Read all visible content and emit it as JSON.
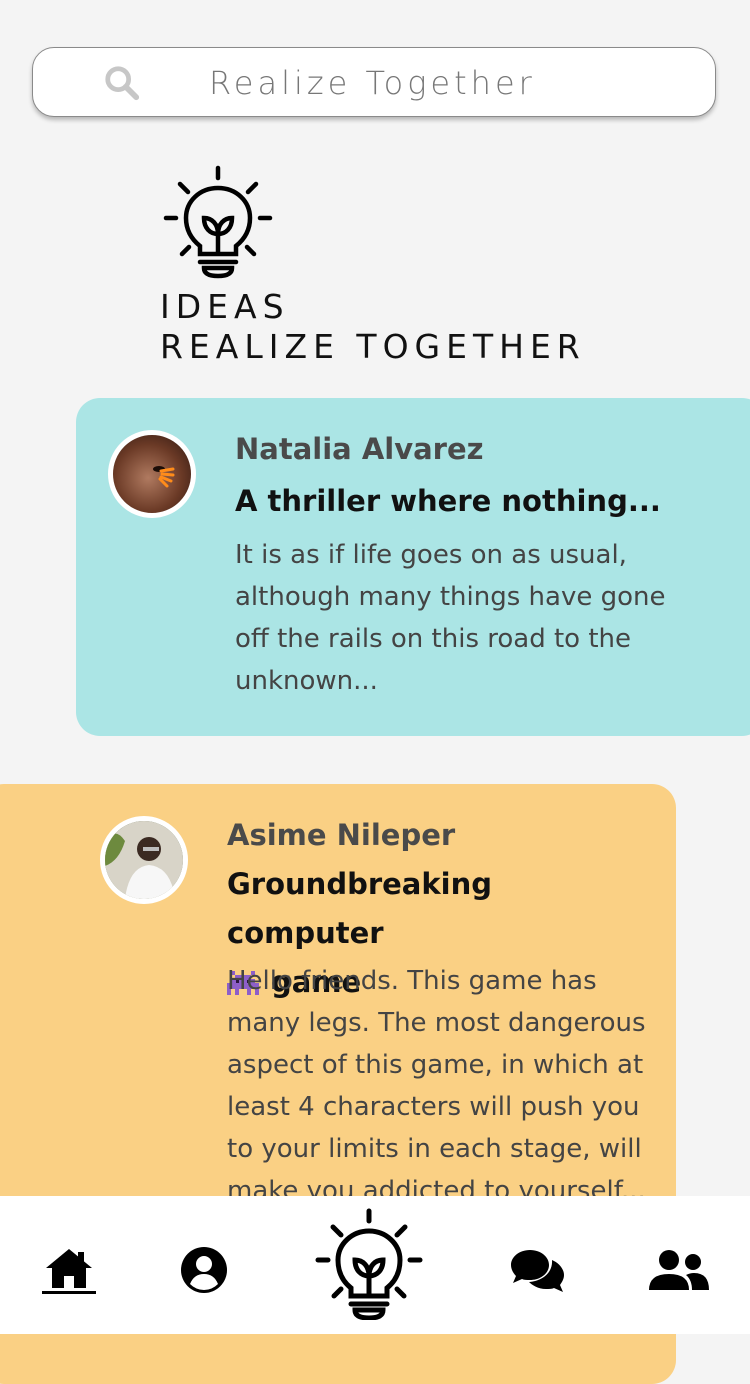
{
  "search": {
    "placeholder": "Realize Together",
    "icon": "search-icon"
  },
  "brand": {
    "line1": "IDEAS",
    "line2": "REALIZE TOGETHER",
    "icon": "lightbulb-icon"
  },
  "posts": [
    {
      "author": "Natalia Alvarez",
      "title": "A thriller where nothing...",
      "body": "It is as if life goes on as usual, although many things have gone off the rails on this road to the unknown...",
      "color": "#abe5e5"
    },
    {
      "author": "Asime Nileper",
      "title_part1": "Groundbreaking computer",
      "title_emoji": "alien-monster-emoji",
      "title_part2": "game",
      "body": "Hello friends. This game has many legs. The most dangerous aspect of this game, in which at least 4 characters will push you to your limits in each stage, will make you addicted to yourself...",
      "color": "#fad084"
    }
  ],
  "nav": {
    "items": [
      "home-icon",
      "profile-icon",
      "ideas-icon",
      "chat-icon",
      "groups-icon"
    ],
    "active": "home-icon"
  }
}
